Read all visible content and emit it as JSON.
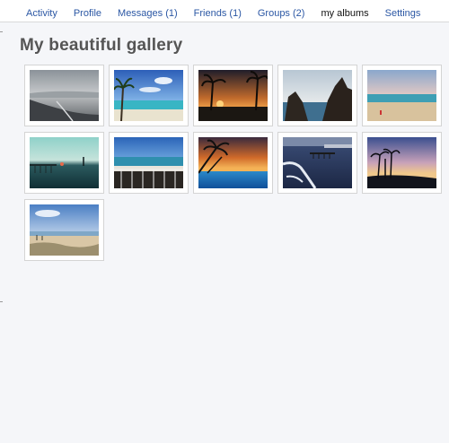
{
  "nav": {
    "items": [
      {
        "label": "Activity"
      },
      {
        "label": "Profile"
      },
      {
        "label": "Messages (1)"
      },
      {
        "label": "Friends (1)"
      },
      {
        "label": "Groups (2)"
      },
      {
        "label": "my albums"
      },
      {
        "label": "Settings"
      }
    ],
    "active_index": 5,
    "link_color": "#2b57a4"
  },
  "page": {
    "title": "My beautiful gallery"
  },
  "gallery": {
    "photos": [
      {
        "subject": "grey-shore"
      },
      {
        "subject": "palm-beach"
      },
      {
        "subject": "palm-sunset"
      },
      {
        "subject": "sea-rocks"
      },
      {
        "subject": "beach-pink-sky"
      },
      {
        "subject": "teal-dusk-pier"
      },
      {
        "subject": "balcony-sea"
      },
      {
        "subject": "palm-sunset-pool"
      },
      {
        "subject": "waves-pier"
      },
      {
        "subject": "palm-silhouette-dusk"
      },
      {
        "subject": "dune-beach"
      }
    ]
  }
}
